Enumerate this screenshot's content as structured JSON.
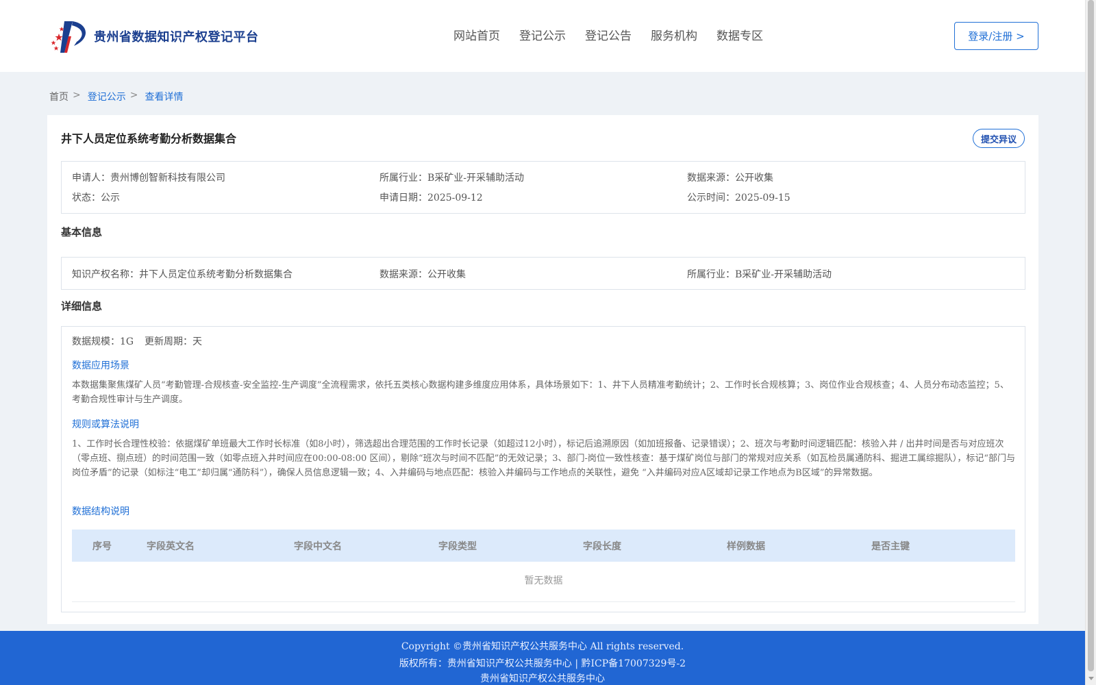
{
  "header": {
    "site_title": "贵州省数据知识产权登记平台",
    "nav": [
      "网站首页",
      "登记公示",
      "登记公告",
      "服务机构",
      "数据专区"
    ],
    "login_label": "登录/注册 >"
  },
  "breadcrumb": {
    "home": "首页",
    "sep": ">",
    "list": "登记公示",
    "current": "查看详情"
  },
  "detail": {
    "title": "井下人员定位系统考勤分析数据集合",
    "objection_label": "提交异议",
    "summary": {
      "applicant_label": "申请人：",
      "applicant": "贵州博创智新科技有限公司",
      "industry_label": "所属行业：",
      "industry": "B采矿业-开采辅助活动",
      "source_label": "数据来源：",
      "source": "公开收集",
      "status_label": "状态：",
      "status": "公示",
      "apply_date_label": "申请日期：",
      "apply_date": "2025-09-12",
      "publish_date_label": "公示时间：",
      "publish_date": "2025-09-15"
    },
    "basic": {
      "section_title": "基本信息",
      "ip_name_label": "知识产权名称：",
      "ip_name": "井下人员定位系统考勤分析数据集合",
      "source_label": "数据来源：",
      "source": "公开收集",
      "industry_label": "所属行业：",
      "industry": "B采矿业-开采辅助活动"
    },
    "details": {
      "section_title": "详细信息",
      "scale_label": "数据规模：",
      "scale": "1G",
      "cycle_label": "更新周期：",
      "cycle": "天",
      "scene_title": "数据应用场景",
      "scene_text": "本数据集聚焦煤矿人员“考勤管理-合规核查-安全监控-生产调度”全流程需求，依托五类核心数据构建多维度应用体系，具体场景如下：1、井下人员精准考勤统计；2、工作时长合规核算；3、岗位作业合规核查；4、人员分布动态监控；5、考勤合规性审计与生产调度。",
      "rule_title": "规则或算法说明",
      "rule_text": "1、工作时长合理性校验：依据煤矿单班最大工作时长标准（如8小时），筛选超出合理范围的工作时长记录（如超过12小时），标记后追溯原因（如加班报备、记录错误）；2、班次与考勤时间逻辑匹配：核验入井 / 出井时间是否与对应班次（零点班、捌点班）的时间范围一致（如零点班入井时间应在00:00-08:00 区间），剔除“班次与时间不匹配”的无效记录；3、部门-岗位一致性核查：基于煤矿岗位与部门的常规对应关系（如瓦检员属通防科、掘进工属综掘队），标记“部门与岗位矛盾”的记录（如标注“电工”却归属“通防科”），确保人员信息逻辑一致；4、入井编码与地点匹配：核验入井编码与工作地点的关联性，避免 “入井编码对应A区域却记录工作地点为B区域”的异常数据。",
      "structure_title": "数据结构说明",
      "table_headers": [
        "序号",
        "字段英文名",
        "字段中文名",
        "字段类型",
        "字段长度",
        "样例数据",
        "是否主键"
      ],
      "empty_text": "暂无数据"
    }
  },
  "footer": {
    "copyright": "Copyright ©贵州省知识产权公共服务中心 All rights reserved.",
    "rights": "版权所有：贵州省知识产权公共服务中心 | 黔ICP备17007329号-2",
    "org": "贵州省知识产权公共服务中心"
  },
  "colors": {
    "accent": "#1f6fd6",
    "footer_bg": "#2166d3",
    "table_head_bg": "#dceafb",
    "page_bg": "#eef2f6"
  }
}
